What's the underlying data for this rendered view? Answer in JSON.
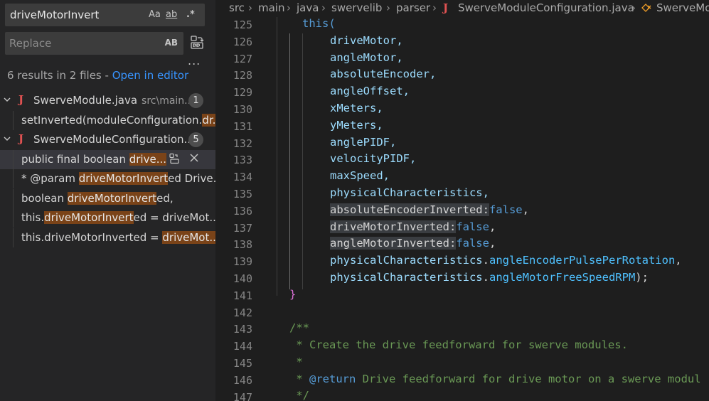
{
  "search": {
    "query": "driveMotorInvert",
    "opt_case": "Aa",
    "opt_word": "ab",
    "opt_regex": ".*",
    "replace_placeholder": "Replace",
    "replace_opt": "AB",
    "more": "...",
    "summary_text": "6 results in 2 files - ",
    "summary_link": "Open in editor"
  },
  "results": [
    {
      "file": "SwerveModule.java",
      "path": "src\\main...",
      "count": "1",
      "matches": [
        {
          "pre": "setInverted(moduleConfiguration.",
          "hit": "dr...",
          "post": ""
        }
      ]
    },
    {
      "file": "SwerveModuleConfiguration...",
      "path": "",
      "count": "5",
      "matches": [
        {
          "pre": "public final boolean ",
          "hit": "drive...",
          "post": ""
        },
        {
          "pre": "* @param ",
          "hit": "driveMotorInvert",
          "post": "ed Drive..."
        },
        {
          "pre": "boolean ",
          "hit": "driveMotorInvert",
          "post": "ed,"
        },
        {
          "pre": "this.",
          "hit": "driveMotorInvert",
          "post": "ed = driveMot..."
        },
        {
          "pre": "this.driveMotorInverted = ",
          "hit": "driveMot...",
          "post": ""
        }
      ]
    }
  ],
  "breadcrumb": {
    "items": [
      "src",
      "main",
      "java",
      "swervelib",
      "parser"
    ],
    "file_icon": "J",
    "file": "SwerveModuleConfiguration.java",
    "symbol": "SwerveMo"
  },
  "code": {
    "line_numbers": [
      "125",
      "126",
      "127",
      "128",
      "129",
      "130",
      "131",
      "132",
      "133",
      "134",
      "135",
      "136",
      "137",
      "138",
      "139",
      "140",
      "141",
      "142",
      "143",
      "144",
      "145",
      "146",
      "147"
    ],
    "this_kw": "this(",
    "args": [
      "driveMotor,",
      "angleMotor,",
      "absoluteEncoder,",
      "angleOffset,",
      "xMeters,",
      "yMeters,",
      "anglePIDF,",
      "velocityPIDF,",
      "maxSpeed,",
      "physicalCharacteristics,"
    ],
    "hints": [
      {
        "name": "absoluteEncoderInverted:",
        "val": "false",
        "tail": ","
      },
      {
        "name": "driveMotorInverted:",
        "val": "false",
        "tail": ","
      },
      {
        "name": "angleMotorInverted:",
        "val": "false",
        "tail": ","
      }
    ],
    "pc_obj": "physicalCharacteristics",
    "pc_dot": ".",
    "pc_field1": "angleEncoderPulsePerRotation",
    "pc_tail1": ",",
    "pc_field2": "angleMotorFreeSpeedRPM",
    "pc_tail2": ");",
    "close_brace": "}",
    "doc_open": "/**",
    "doc_1": " * Create the drive feedforward for swerve modules.",
    "doc_2": " *",
    "doc_3_star": " * ",
    "doc_3_tag": "@return",
    "doc_3_rest": " Drive feedforward for drive motor on a swerve modul",
    "doc_close": " */"
  }
}
